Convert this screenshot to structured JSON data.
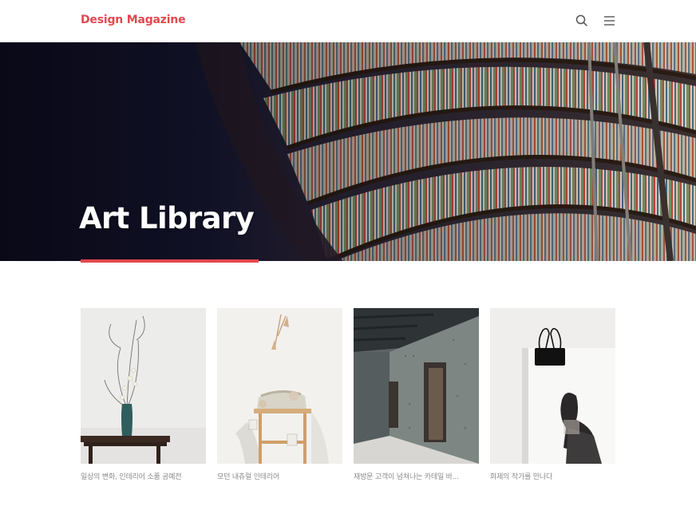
{
  "header": {
    "logo": "Design Magazine",
    "search_icon": "search-icon",
    "menu_icon": "hamburger-menu-icon"
  },
  "hero": {
    "title": "Art Library",
    "image": "library-bookshelves-photo",
    "accent_color": "#e2484e"
  },
  "cards": [
    {
      "caption": "일상의 변화, 인테리어 소품 공예전",
      "image": "vase-with-branches-photo"
    },
    {
      "caption": "모던 내츄럴 인테리어",
      "image": "wooden-stool-with-knit-photo"
    },
    {
      "caption": "재방문 고객이 넘쳐나는 카테일 바...",
      "image": "concrete-corridor-photo"
    },
    {
      "caption": "화제의 작가를 만나다",
      "image": "magazine-with-binder-clip-photo"
    }
  ],
  "colors": {
    "brand": "#e2484e",
    "caption_text": "#8a8a8a"
  }
}
